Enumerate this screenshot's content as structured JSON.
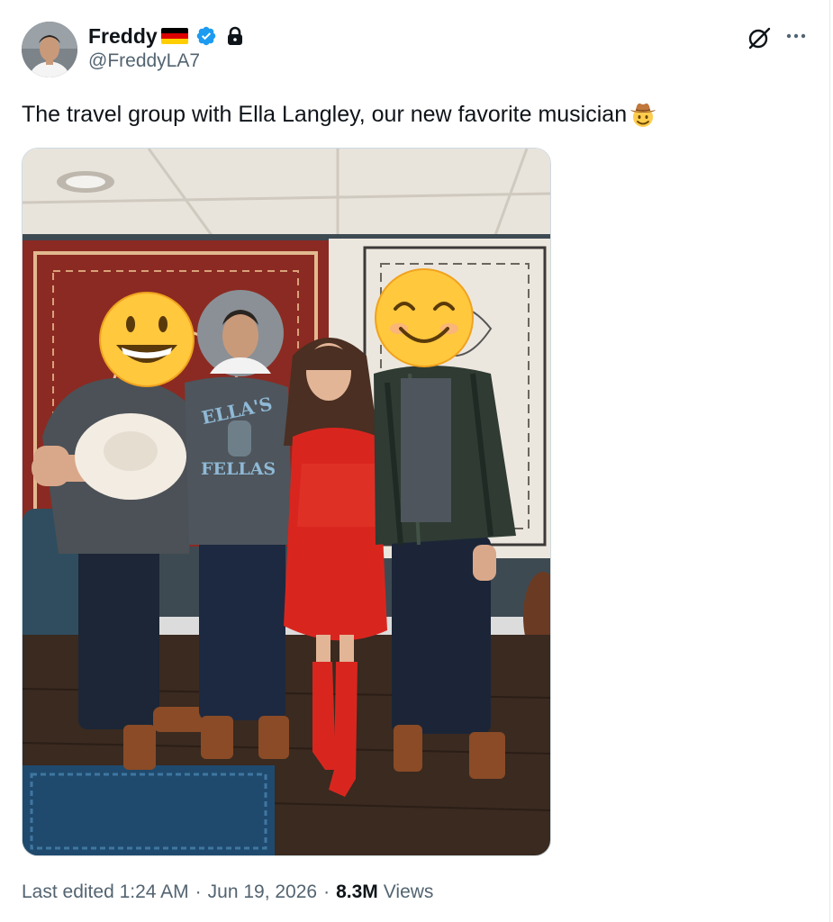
{
  "user": {
    "display_name": "Freddy",
    "handle": "@FreddyLA7",
    "flag_colors": [
      "#000000",
      "#dd0000",
      "#ffce00"
    ],
    "verified_color": "#1d9bf0"
  },
  "icons": {
    "avatar": "profile-photo",
    "verified": "verified-badge-icon",
    "lock": "lock-icon",
    "grok": "grok-icon",
    "more": "more-icon",
    "cowboy": "cowboy-hat-face-emoji"
  },
  "tweet": {
    "text": "The travel group with Ella Langley, our new favorite musician",
    "media_alt": "Four people posing indoors in front of decorative tapestries"
  },
  "meta": {
    "edited_label": "Last edited",
    "time": "1:24 AM",
    "date": "Jun 19, 2026",
    "views_count": "8.3M",
    "views_label": "Views",
    "separator": "·"
  },
  "photo": {
    "shirt_text_line1": "ELLA'S",
    "shirt_text_line2": "FELLAS"
  }
}
